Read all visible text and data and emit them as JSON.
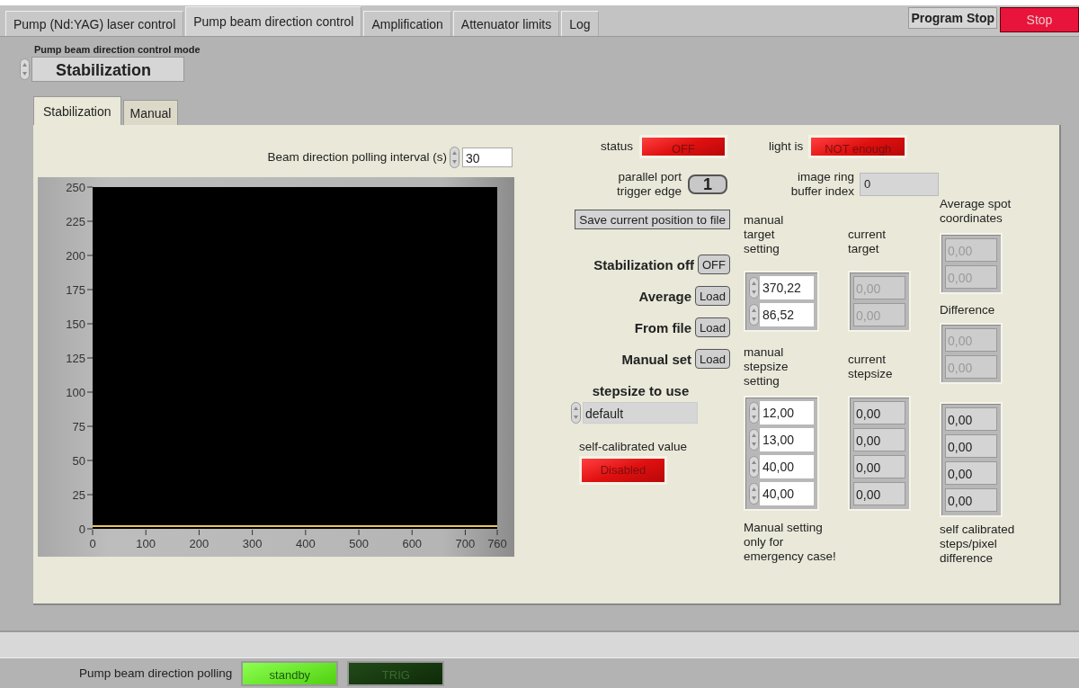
{
  "tabs": [
    {
      "label": "Pump (Nd:YAG) laser control",
      "selected": false
    },
    {
      "label": "Pump beam direction control",
      "selected": true
    },
    {
      "label": "Amplification",
      "selected": false
    },
    {
      "label": "Attenuator limits",
      "selected": false
    },
    {
      "label": "Log",
      "selected": false
    }
  ],
  "program_stop": {
    "label": "Program Stop",
    "button": "Stop"
  },
  "mode": {
    "label": "Pump beam direction control mode",
    "value": "Stabilization"
  },
  "inner_tabs": [
    {
      "label": "Stabilization",
      "selected": true
    },
    {
      "label": "Manual",
      "selected": false
    }
  ],
  "polling_interval": {
    "label": "Beam direction polling interval (s)",
    "value": "30"
  },
  "chart_data": {
    "type": "line",
    "x": [
      0,
      760
    ],
    "xlim": [
      0,
      760
    ],
    "ylim": [
      0,
      250
    ],
    "xticks": [
      0,
      100,
      200,
      300,
      400,
      500,
      600,
      700,
      760
    ],
    "yticks": [
      0,
      25,
      50,
      75,
      100,
      125,
      150,
      175,
      200,
      225,
      250
    ],
    "series": [
      {
        "color": "#e8c860",
        "values": [
          2,
          2
        ]
      }
    ]
  },
  "status": {
    "label": "status",
    "led": "OFF"
  },
  "light": {
    "label": "light is",
    "led": "NOT enough"
  },
  "trigger_edge": {
    "label": "parallel port trigger edge",
    "value": "1"
  },
  "buffer_index": {
    "label": "image ring buffer index",
    "value": "0"
  },
  "save_button": "Save current position to file",
  "load_rows": [
    {
      "label": "Stabilization off",
      "button": "OFF"
    },
    {
      "label": "Average",
      "button": "Load"
    },
    {
      "label": "From file",
      "button": "Load"
    },
    {
      "label": "Manual set",
      "button": "Load"
    }
  ],
  "stepsize": {
    "label": "stepsize to use",
    "value": "default"
  },
  "self_calibrated": {
    "label": "self-calibrated value",
    "led": "Disabled"
  },
  "manual_target": {
    "label": "manual target setting",
    "values": [
      "370,22",
      "86,52"
    ]
  },
  "current_target": {
    "label": "current target",
    "disabled": true,
    "values": [
      "0,00",
      "0,00"
    ]
  },
  "manual_stepsize": {
    "label": "manual stepsize setting",
    "values": [
      "12,00",
      "13,00",
      "40,00",
      "40,00"
    ]
  },
  "current_stepsize": {
    "label": "current stepsize",
    "disabled": false,
    "values": [
      "0,00",
      "0,00",
      "0,00",
      "0,00"
    ]
  },
  "note": "Manual setting only for emergency case!",
  "average_spot": {
    "label": "Average spot coordinates",
    "disabled": true,
    "values": [
      "0,00",
      "0,00"
    ]
  },
  "difference": {
    "label": "Difference",
    "disabled": true,
    "values": [
      "0,00",
      "0,00"
    ]
  },
  "self_calibrated_steps": {
    "label": "self calibrated steps/pixel difference",
    "disabled": false,
    "values": [
      "0,00",
      "0,00",
      "0,00",
      "0,00"
    ]
  },
  "polling": {
    "label": "Pump beam direction polling",
    "indicators": [
      {
        "label": "standby",
        "on": true
      },
      {
        "label": "TRIG",
        "on": false
      }
    ]
  }
}
